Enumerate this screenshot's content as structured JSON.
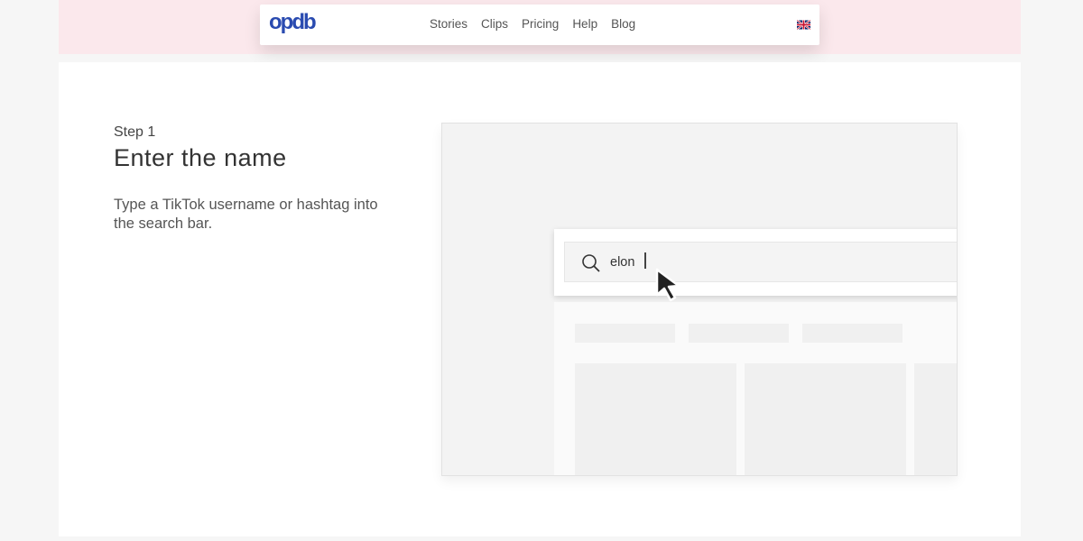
{
  "nav": {
    "logo": "opdb",
    "links": [
      "Stories",
      "Clips",
      "Pricing",
      "Help",
      "Blog"
    ],
    "language_icon": "uk-flag-icon"
  },
  "step": {
    "label": "Step 1",
    "title": "Enter the name",
    "description": "Type a TikTok username or hashtag into the search bar."
  },
  "mock": {
    "search_value": "elon",
    "search_icon": "search-icon",
    "cursor_icon": "mouse-pointer-icon"
  },
  "colors": {
    "brand": "#2a4bb0",
    "band": "#fbe8ec"
  }
}
